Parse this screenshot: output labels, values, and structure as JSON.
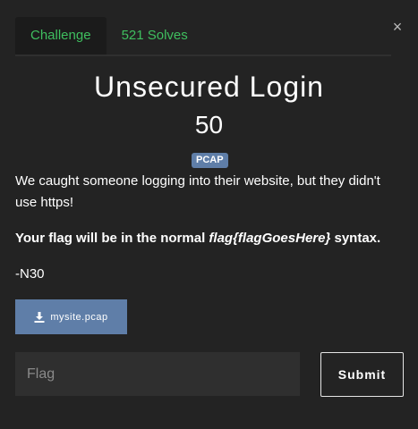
{
  "tabs": [
    {
      "label": "Challenge",
      "active": true
    },
    {
      "label": "521 Solves",
      "active": false
    }
  ],
  "close_label": "×",
  "challenge": {
    "name": "Unsecured Login",
    "points": "50",
    "tag": "PCAP",
    "description": {
      "line1": "We caught someone logging into their website, but they didn't use https!",
      "line2_prefix": "Your flag will be in the normal ",
      "line2_italic": "flag{flagGoesHere}",
      "line2_suffix": " syntax.",
      "line3": "-N30"
    }
  },
  "file": {
    "label": "mysite.pcap",
    "icon": "download-icon"
  },
  "flag_input": {
    "placeholder": "Flag",
    "value": ""
  },
  "submit_label": "Submit",
  "colors": {
    "background": "#232323",
    "accent_green": "#3fbf5f",
    "tag_blue": "#5f7ea8",
    "input_bg": "#2f2f2f"
  }
}
